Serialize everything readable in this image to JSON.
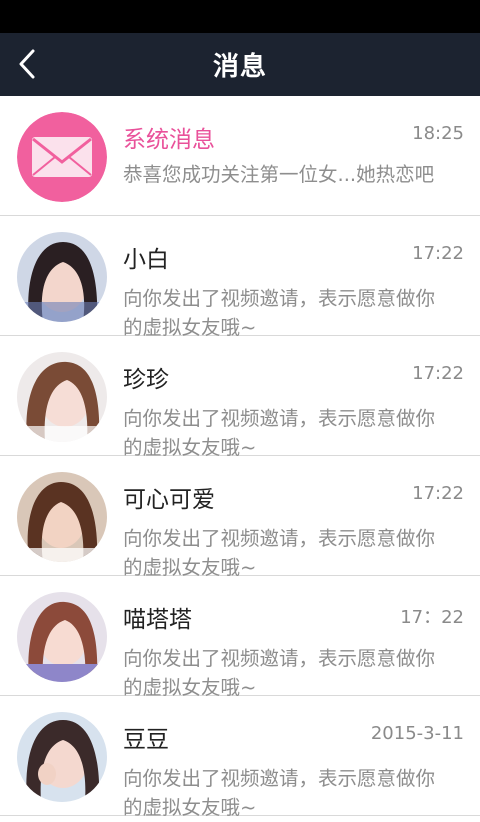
{
  "header": {
    "title": "消息",
    "back_icon": "chevron-left-icon"
  },
  "colors": {
    "header_bg": "#1c2330",
    "accent_pink": "#e9519a",
    "system_avatar_bg": "#f1609e"
  },
  "system_message": {
    "name": "系统消息",
    "time": "18:25",
    "preview": "恭喜您成功关注第一位女...她热恋吧",
    "icon": "envelope-icon"
  },
  "conversations": [
    {
      "name": "小白",
      "time": "17:22",
      "preview": "向你发出了视频邀请，表示愿意做你的虚拟女友哦~"
    },
    {
      "name": "珍珍",
      "time": "17:22",
      "preview": "向你发出了视频邀请，表示愿意做你的虚拟女友哦~"
    },
    {
      "name": "可心可爱",
      "time": "17:22",
      "preview": "向你发出了视频邀请，表示愿意做你的虚拟女友哦~"
    },
    {
      "name": "喵塔塔",
      "time": "17：22",
      "preview": "向你发出了视频邀请，表示愿意做你的虚拟女友哦~"
    },
    {
      "name": "豆豆",
      "time": "2015-3-11",
      "preview": "向你发出了视频邀请，表示愿意做你的虚拟女友哦~"
    }
  ]
}
